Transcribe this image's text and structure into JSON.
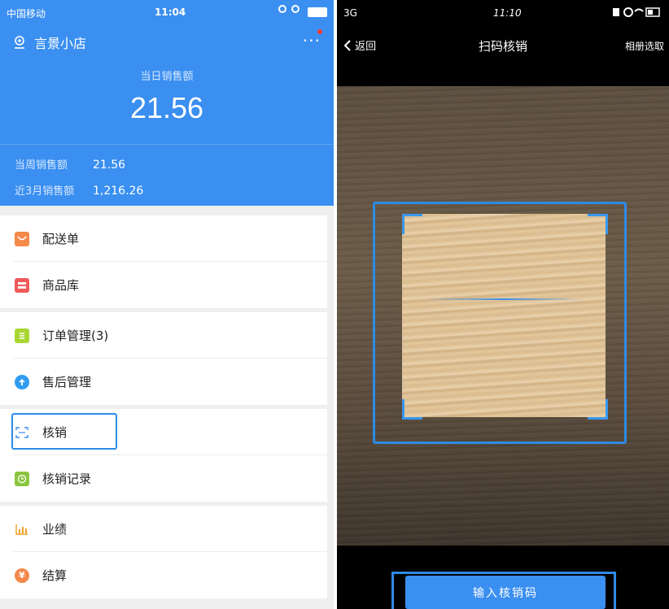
{
  "left": {
    "status_bar": {
      "carrier": "中国移动",
      "time": "11:04"
    },
    "store_name": "言景小店",
    "more_label": "···",
    "today_sales_label": "当日销售额",
    "today_sales_value": "21.56",
    "week_sales_label": "当周销售额",
    "week_sales_value": "21.56",
    "quarter_sales_label": "近3月销售额",
    "quarter_sales_value": "1,216.26",
    "menu": [
      {
        "label": "配送单",
        "icon": "delivery-icon",
        "color": "#f5894a"
      },
      {
        "label": "商品库",
        "icon": "product-library-icon",
        "color": "#f05a5a"
      },
      {
        "label": "订单管理(3)",
        "icon": "order-icon",
        "color": "#a9d633"
      },
      {
        "label": "售后管理",
        "icon": "after-sales-icon",
        "color": "#2f9cf0"
      },
      {
        "label": "核销",
        "icon": "scan-icon",
        "color": "#3a8ff0"
      },
      {
        "label": "核销记录",
        "icon": "clock-icon",
        "color": "#8bc53f"
      },
      {
        "label": "业绩",
        "icon": "bar-chart-icon",
        "color": "#f0a020"
      },
      {
        "label": "结算",
        "icon": "yen-icon",
        "color": "#f5894a"
      }
    ],
    "accent_color": "#3a8ff0"
  },
  "right": {
    "status_bar": {
      "network": "3G",
      "time": "11:10"
    },
    "back_label": "返回",
    "title": "扫码核销",
    "album_label": "相册选取",
    "input_button_label": "输入核销码"
  }
}
